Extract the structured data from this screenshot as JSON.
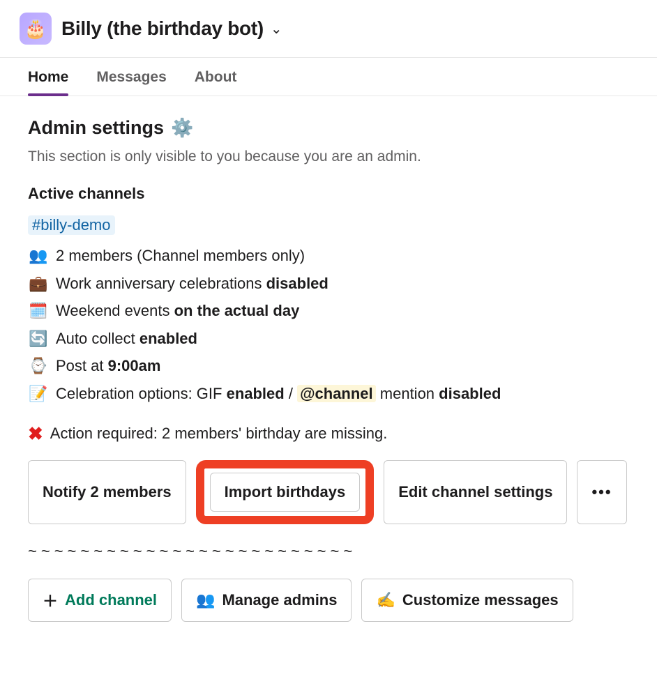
{
  "header": {
    "app_name": "Billy (the birthday bot)",
    "icon_emoji": "🎂"
  },
  "tabs": [
    {
      "label": "Home",
      "active": true
    },
    {
      "label": "Messages",
      "active": false
    },
    {
      "label": "About",
      "active": false
    }
  ],
  "section_title": "Admin settings",
  "gear_icon": "⚙️",
  "subtext": "This section is only visible to you because you are an admin.",
  "active_channels_heading": "Active channels",
  "channel_name": "#billy-demo",
  "info": {
    "members_emoji": "👥",
    "members_text_prefix": "2 members ",
    "members_text_suffix": "(Channel members only)",
    "anniversary_emoji": "💼",
    "anniversary_text": "Work anniversary celebrations ",
    "anniversary_state": "disabled",
    "weekend_emoji": "🗓️",
    "weekend_text": "Weekend events ",
    "weekend_state": "on the actual day",
    "autocollect_emoji": "🔄",
    "autocollect_text": "Auto collect ",
    "autocollect_state": "enabled",
    "post_emoji": "⌚",
    "post_text": "Post at ",
    "post_time": "9:00am",
    "celebrate_emoji": "📝",
    "celebrate_prefix": "Celebration options: GIF ",
    "celebrate_gif_state": "enabled",
    "celebrate_mid": " / ",
    "celebrate_mention": "@channel",
    "celebrate_mention_after": " mention ",
    "celebrate_mention_state": "disabled"
  },
  "action_required": {
    "icon": "✖",
    "text": "Action required: 2 members' birthday are missing."
  },
  "buttons_row1": {
    "notify": "Notify 2 members",
    "import": "Import birthdays",
    "edit": "Edit channel settings",
    "overflow": "•••"
  },
  "divider": "~~~~~~~~~~~~~~~~~~~~~~~~~",
  "buttons_row2": {
    "add_channel_icon": "＋",
    "add_channel": "Add channel",
    "manage_admins_icon": "👥",
    "manage_admins": "Manage admins",
    "customize_icon": "✍️",
    "customize": "Customize messages"
  }
}
